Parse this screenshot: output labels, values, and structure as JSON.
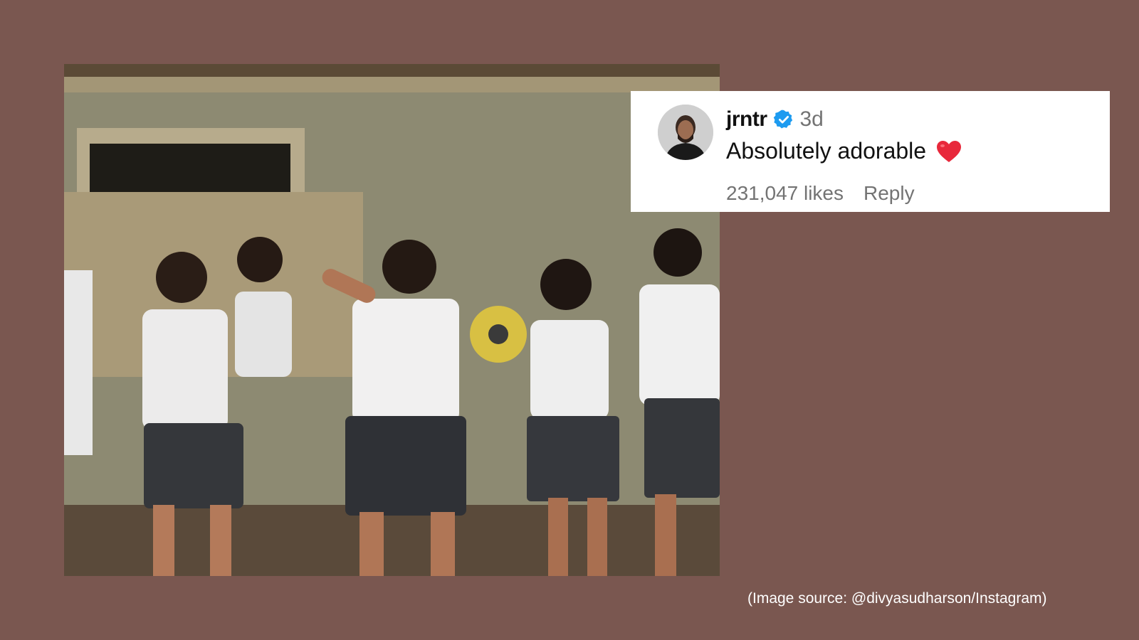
{
  "comment": {
    "username": "jrntr",
    "timestamp": "3d",
    "text": "Absolutely adorable",
    "likes": "231,047 likes",
    "reply_label": "Reply",
    "icons": {
      "verified": "verified-badge-icon",
      "heart": "red-heart-emoji"
    },
    "colors": {
      "verified": "#1d9bf0",
      "heart": "#e8283b",
      "meta": "#737373"
    }
  },
  "caption": "(Image source: @divyasudharson/Instagram)",
  "colors": {
    "background": "#7a5750"
  }
}
